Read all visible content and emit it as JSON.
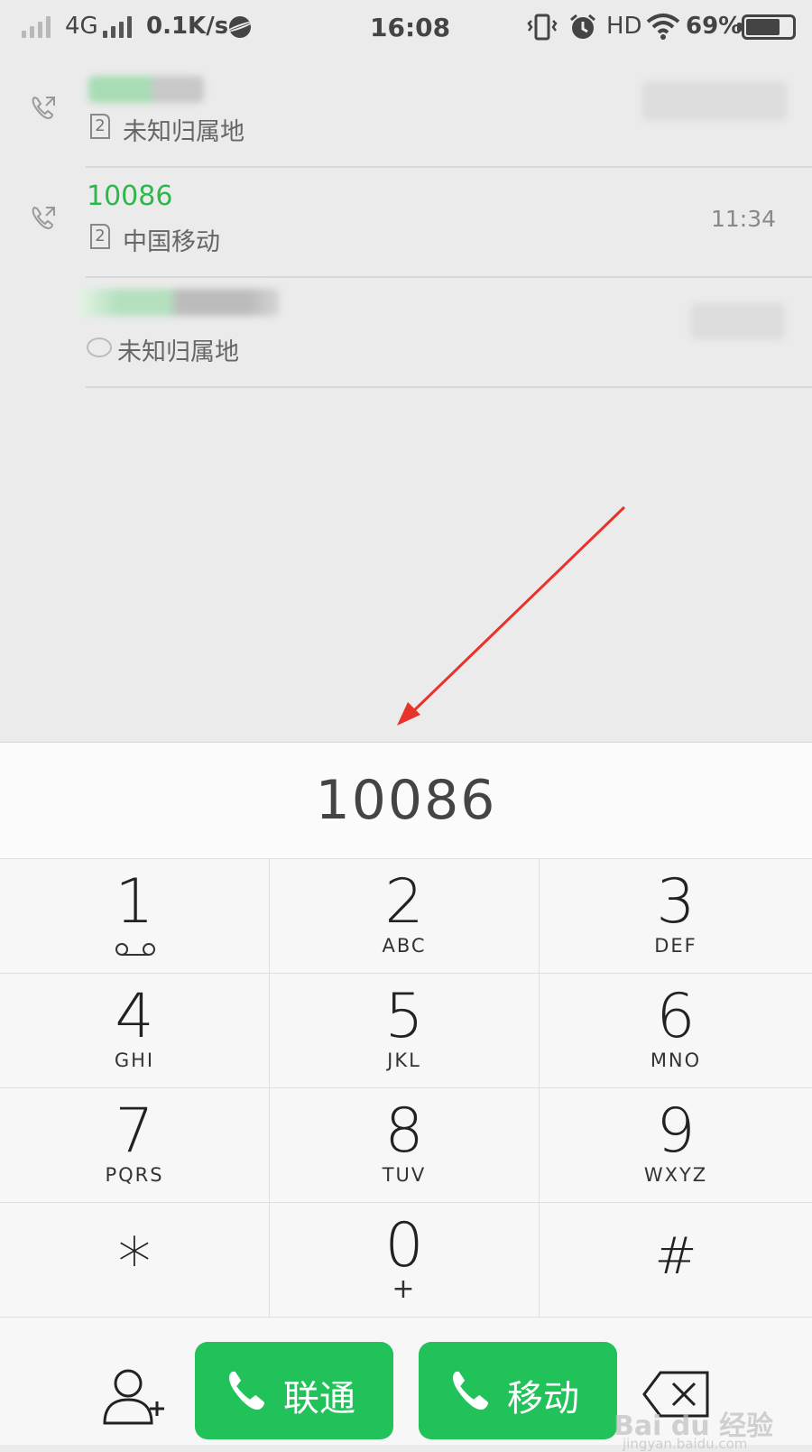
{
  "status": {
    "network": "4G",
    "speed": "0.1K/s",
    "time": "16:08",
    "hd": "HD",
    "battery": "69%"
  },
  "calls": [
    {
      "number": "",
      "sim": "2",
      "location": "未知归属地",
      "time": ""
    },
    {
      "number": "10086",
      "sim": "2",
      "location": "中国移动",
      "time": "11:34"
    },
    {
      "number": "",
      "sim": "",
      "location": "未知归属地",
      "time": ""
    }
  ],
  "dialer": {
    "input": "10086",
    "keys": [
      {
        "digit": "1",
        "letters": ""
      },
      {
        "digit": "2",
        "letters": "ABC"
      },
      {
        "digit": "3",
        "letters": "DEF"
      },
      {
        "digit": "4",
        "letters": "GHI"
      },
      {
        "digit": "5",
        "letters": "JKL"
      },
      {
        "digit": "6",
        "letters": "MNO"
      },
      {
        "digit": "7",
        "letters": "PQRS"
      },
      {
        "digit": "8",
        "letters": "TUV"
      },
      {
        "digit": "9",
        "letters": "WXYZ"
      },
      {
        "digit": "*",
        "letters": ""
      },
      {
        "digit": "0",
        "letters": "+"
      },
      {
        "digit": "#",
        "letters": ""
      }
    ],
    "call_unicom": "联通",
    "call_mobile": "移动"
  },
  "watermark": {
    "text": "Bai du 经验",
    "url": "jingyan.baidu.com"
  },
  "colors": {
    "accent_green": "#22c25a",
    "number_green": "#2db84e",
    "arrow_red": "#e8322a"
  }
}
